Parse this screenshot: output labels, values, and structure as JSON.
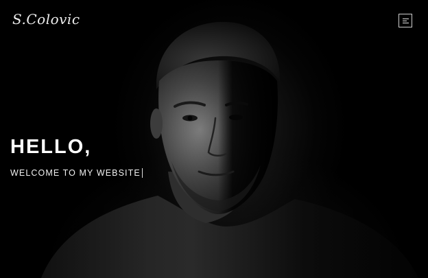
{
  "header": {
    "logo_text": "S.Colovic",
    "menu_icon": "menu-icon"
  },
  "hero": {
    "title": "HELLO,",
    "subtitle": "WELCOME TO MY WEBSITE",
    "background_image": "portrait-photo"
  },
  "colors": {
    "background": "#000000",
    "text": "#ffffff"
  }
}
